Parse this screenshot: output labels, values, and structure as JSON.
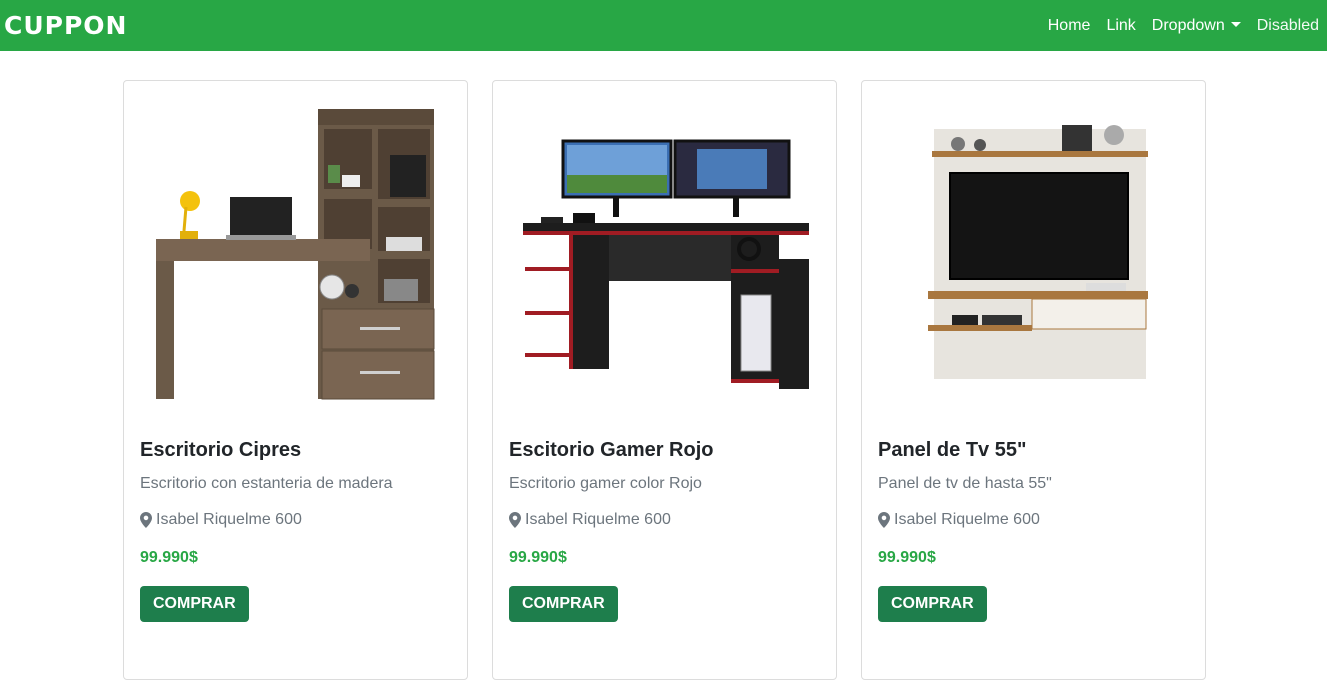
{
  "navbar": {
    "brand": "CUPPON",
    "links": [
      "Home",
      "Link",
      "Dropdown",
      "Disabled"
    ]
  },
  "products": [
    {
      "title": "Escritorio Cipres",
      "description": "Escritorio con estanteria de madera",
      "location": "Isabel Riquelme 600",
      "price": "99.990$",
      "button": "COMPRAR"
    },
    {
      "title": "Escitorio Gamer Rojo",
      "description": "Escritorio gamer color Rojo",
      "location": "Isabel Riquelme 600",
      "price": "99.990$",
      "button": "COMPRAR"
    },
    {
      "title": "Panel de Tv 55\"",
      "description": "Panel de tv de hasta 55\"",
      "location": "Isabel Riquelme 600",
      "price": "99.990$",
      "button": "COMPRAR"
    }
  ],
  "colors": {
    "navbar": "#28a745",
    "price": "#28a745",
    "button": "#1e7e4c"
  },
  "icons": {
    "location": "map-marker-icon"
  }
}
